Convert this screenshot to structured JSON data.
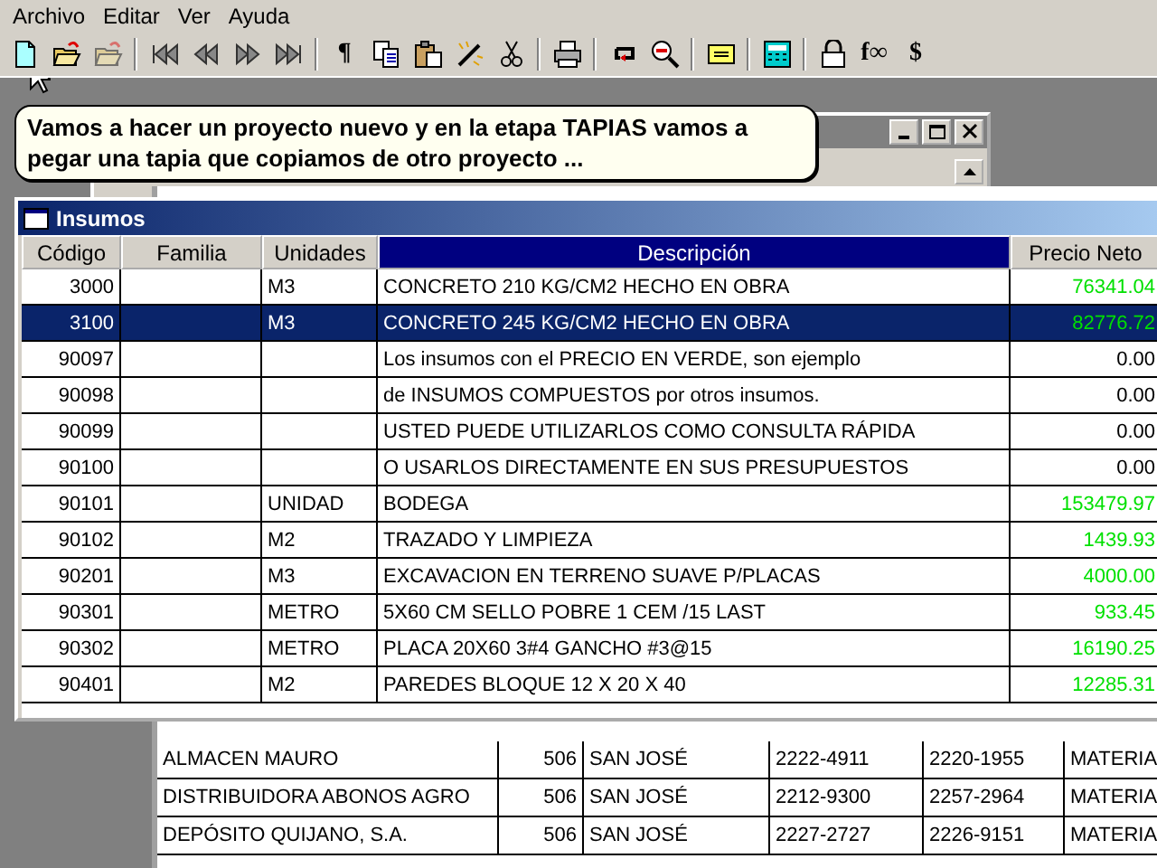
{
  "menu": [
    "Archivo",
    "Editar",
    "Ver",
    "Ayuda"
  ],
  "toolbar": [
    {
      "kind": "new",
      "disabled": false
    },
    {
      "kind": "open",
      "disabled": false
    },
    {
      "kind": "open",
      "disabled": true
    },
    {
      "kind": "separator"
    },
    {
      "kind": "first",
      "disabled": false
    },
    {
      "kind": "prev",
      "disabled": false
    },
    {
      "kind": "next",
      "disabled": false
    },
    {
      "kind": "last",
      "disabled": false
    },
    {
      "kind": "separator"
    },
    {
      "kind": "glyph",
      "label": "¶",
      "disabled": false
    },
    {
      "kind": "copy",
      "disabled": false
    },
    {
      "kind": "paste",
      "disabled": false
    },
    {
      "kind": "wand",
      "disabled": false
    },
    {
      "kind": "cut",
      "disabled": false
    },
    {
      "kind": "separator"
    },
    {
      "kind": "print",
      "disabled": false
    },
    {
      "kind": "separator"
    },
    {
      "kind": "loop",
      "disabled": false
    },
    {
      "kind": "zoom-out",
      "disabled": false
    },
    {
      "kind": "separator"
    },
    {
      "kind": "note",
      "disabled": false
    },
    {
      "kind": "separator"
    },
    {
      "kind": "calculator",
      "disabled": false
    },
    {
      "kind": "separator"
    },
    {
      "kind": "lock",
      "disabled": false
    },
    {
      "kind": "glyph",
      "label": "f∞",
      "disabled": false
    },
    {
      "kind": "glyph",
      "label": "$",
      "disabled": false
    }
  ],
  "tooltip": "Vamos a hacer un proyecto nuevo y en la etapa TAPIAS vamos a pegar una tapia que copiamos de otro proyecto ...",
  "suppliers": {
    "rows": [
      [
        "ALMACEN MAURO",
        "506",
        "SAN JOSÉ",
        "2222-4911",
        "2220-1955",
        "MATERIA"
      ],
      [
        "DISTRIBUIDORA ABONOS AGRO",
        "506",
        "SAN JOSÉ",
        "2212-9300",
        "2257-2964",
        "MATERIA"
      ],
      [
        "DEPÓSITO QUIJANO, S.A.",
        "506",
        "SAN JOSÉ",
        "2227-2727",
        "2226-9151",
        "MATERIA"
      ]
    ]
  },
  "insumos": {
    "title": "Insumos",
    "columns": [
      {
        "label": "Código",
        "selected": false
      },
      {
        "label": "Familia",
        "selected": false
      },
      {
        "label": "Unidades",
        "selected": false
      },
      {
        "label": "Descripción",
        "selected": true
      },
      {
        "label": "Precio Neto",
        "selected": false
      }
    ],
    "rows": [
      {
        "code": "3000",
        "unit": "M3",
        "description": "CONCRETO 210 KG/CM2 HECHO EN OBRA",
        "price": "76341.04",
        "green": true,
        "selected": false
      },
      {
        "code": "3100",
        "unit": "M3",
        "description": "CONCRETO 245 KG/CM2 HECHO EN OBRA",
        "price": "82776.72",
        "green": true,
        "selected": true
      },
      {
        "code": "90097",
        "description": "Los insumos con el PRECIO EN VERDE, son ejemplo",
        "price": "0.00",
        "green": false,
        "selected": false
      },
      {
        "code": "90098",
        "description": "de INSUMOS COMPUESTOS por otros insumos.",
        "price": "0.00",
        "green": false,
        "selected": false
      },
      {
        "code": "90099",
        "description": "USTED PUEDE UTILIZARLOS COMO CONSULTA RÁPIDA",
        "price": "0.00",
        "green": false,
        "selected": false
      },
      {
        "code": "90100",
        "description": "O USARLOS DIRECTAMENTE EN SUS PRESUPUESTOS",
        "price": "0.00",
        "green": false,
        "selected": false
      },
      {
        "code": "90101",
        "unit": "UNIDAD",
        "description": "BODEGA",
        "price": "153479.97",
        "green": true,
        "selected": false
      },
      {
        "code": "90102",
        "unit": "M2",
        "description": "TRAZADO Y LIMPIEZA",
        "price": "1439.93",
        "green": true,
        "selected": false
      },
      {
        "code": "90201",
        "unit": "M3",
        "description": "EXCAVACION EN TERRENO SUAVE P/PLACAS",
        "price": "4000.00",
        "green": true,
        "selected": false
      },
      {
        "code": "90301",
        "unit": "METRO",
        "description": "5X60 CM SELLO POBRE 1 CEM /15 LAST",
        "price": "933.45",
        "green": true,
        "selected": false
      },
      {
        "code": "90302",
        "unit": "METRO",
        "description": "PLACA 20X60 3#4 GANCHO #3@15",
        "price": "16190.25",
        "green": true,
        "selected": false
      },
      {
        "code": "90401",
        "unit": "M2",
        "description": "PAREDES BLOQUE 12 X 20 X 40",
        "price": "12285.31",
        "green": true,
        "selected": false
      }
    ]
  }
}
